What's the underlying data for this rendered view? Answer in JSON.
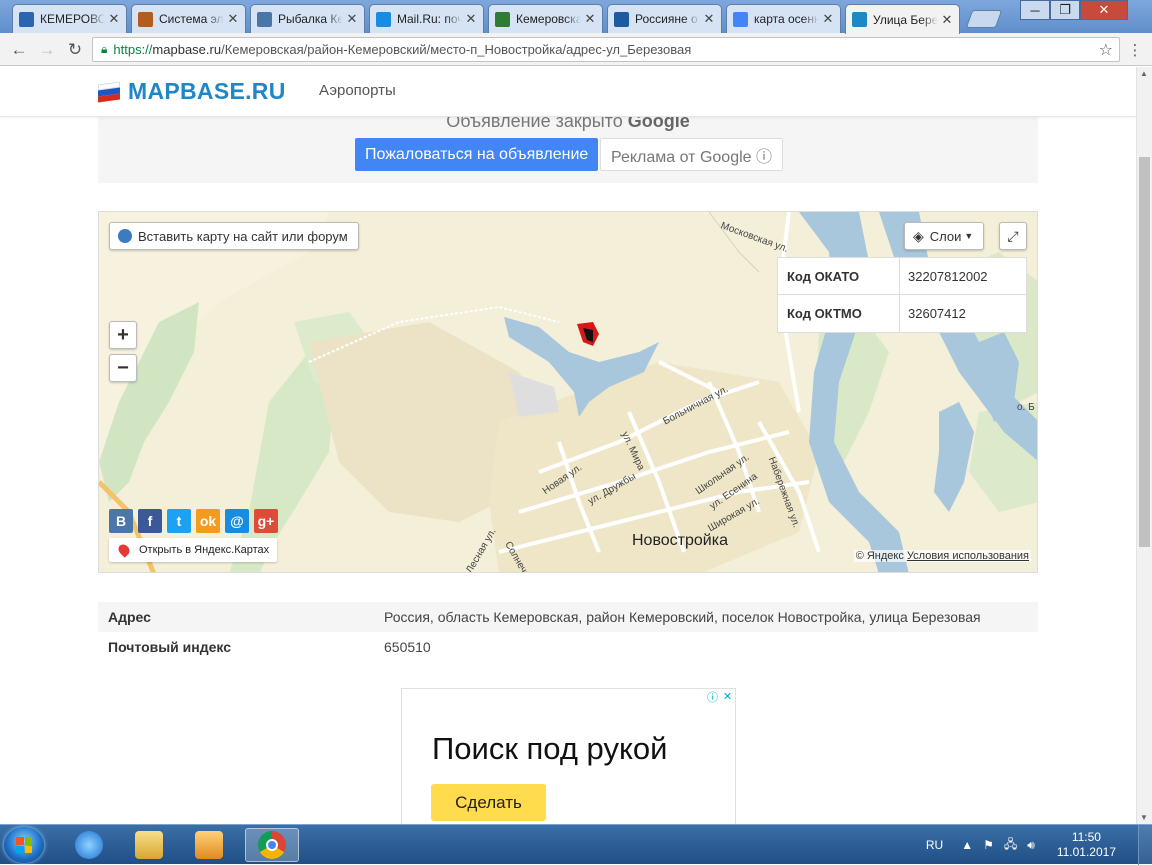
{
  "browser": {
    "tabs": [
      {
        "title": "КЕМЕРОВСКАЯ",
        "favicon": "wave-icon",
        "color": "#2b64b5",
        "active": false
      },
      {
        "title": "Система электронного",
        "favicon": "bank-icon",
        "color": "#b35c1e",
        "active": false
      },
      {
        "title": "Рыбалка Кемерово",
        "favicon": "vk-icon",
        "color": "#4a76a8",
        "active": false
      },
      {
        "title": "Mail.Ru: почта",
        "favicon": "mailru-icon",
        "color": "#168de2",
        "active": false
      },
      {
        "title": "Кемеровская область",
        "favicon": "kemerovo-icon",
        "color": "#2e7d32",
        "active": false
      },
      {
        "title": "Россияне о",
        "favicon": "window-icon",
        "color": "#1e5aa0",
        "active": false
      },
      {
        "title": "карта осенних",
        "favicon": "google-icon",
        "color": "#4285f4",
        "active": false
      },
      {
        "title": "Улица Березовая",
        "favicon": "russia-flag-icon",
        "color": "#1e88c7",
        "active": true
      }
    ],
    "url_https": "https://",
    "url_host": "mapbase.ru",
    "url_path": "/Кемеровская/район-Кемеровский/место-п_Новостройка/адрес-ул_Березовая"
  },
  "site": {
    "logo_text": "MAPBASE.RU",
    "nav_airports": "Аэропорты"
  },
  "ad_top": {
    "closed_text": "Объявление закрыто",
    "closed_brand": "Google",
    "complain_label": "Пожаловаться на объявление",
    "ads_by_label": "Реклама от Google ⓘ"
  },
  "map": {
    "embed_label": "Вставить карту на сайт или форум",
    "layers_label": "Слои",
    "codes": [
      {
        "key": "Код ОКАТО",
        "value": "32207812002"
      },
      {
        "key": "Код ОКТМО",
        "value": "32607412"
      }
    ],
    "social": [
      {
        "name": "vkontakte",
        "glyph": "В",
        "color": "#4a76a8"
      },
      {
        "name": "facebook",
        "glyph": "f",
        "color": "#3b5998"
      },
      {
        "name": "twitter",
        "glyph": "t",
        "color": "#1da1f2"
      },
      {
        "name": "odnoklassniki",
        "glyph": "ok",
        "color": "#f29b1f"
      },
      {
        "name": "mailru",
        "glyph": "@",
        "color": "#168de2"
      },
      {
        "name": "googleplus",
        "glyph": "g+",
        "color": "#dd4b39"
      }
    ],
    "open_yandex_label": "Открыть в Яндекс.Картах",
    "town_label": "Новостройка",
    "copyright": "© Яндекс",
    "terms_link": "Условия использования",
    "streets": [
      "Московская ул.",
      "Больничная ул.",
      "ул. Мира",
      "Новая ул.",
      "ул. Дружбы",
      "Школьная ул.",
      "ул. Есенина",
      "Набережная ул.",
      "Широкая ул.",
      "Солнечная",
      "Лесная ул.",
      "о. Б"
    ]
  },
  "info": [
    {
      "key": "Адрес",
      "value": "Россия, область Кемеровская, район Кемеровский, поселок Новостройка, улица Березовая"
    },
    {
      "key": "Почтовый индекс",
      "value": "650510"
    }
  ],
  "ad_bottom": {
    "headline": "Поиск под рукой",
    "button_label": "Сделать"
  },
  "taskbar": {
    "lang": "RU",
    "time": "11:50",
    "date": "11.01.2017"
  }
}
